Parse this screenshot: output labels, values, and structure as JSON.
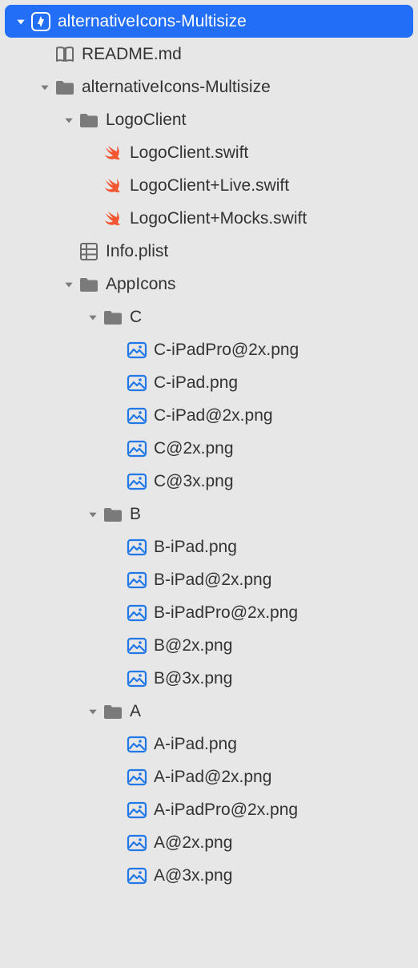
{
  "tree": {
    "root": {
      "label": "alternativeIcons-Multisize",
      "icon": "project",
      "selected": true,
      "expanded": true,
      "children": [
        {
          "label": "README.md",
          "icon": "readme",
          "expanded": null
        },
        {
          "label": "alternativeIcons-Multisize",
          "icon": "folder",
          "expanded": true,
          "children": [
            {
              "label": "LogoClient",
              "icon": "folder",
              "expanded": true,
              "children": [
                {
                  "label": "LogoClient.swift",
                  "icon": "swift",
                  "expanded": null
                },
                {
                  "label": "LogoClient+Live.swift",
                  "icon": "swift",
                  "expanded": null
                },
                {
                  "label": "LogoClient+Mocks.swift",
                  "icon": "swift",
                  "expanded": null
                }
              ]
            },
            {
              "label": "Info.plist",
              "icon": "plist",
              "expanded": null
            },
            {
              "label": "AppIcons",
              "icon": "folder",
              "expanded": true,
              "children": [
                {
                  "label": "C",
                  "icon": "folder",
                  "expanded": true,
                  "children": [
                    {
                      "label": "C-iPadPro@2x.png",
                      "icon": "image",
                      "expanded": null
                    },
                    {
                      "label": "C-iPad.png",
                      "icon": "image",
                      "expanded": null
                    },
                    {
                      "label": "C-iPad@2x.png",
                      "icon": "image",
                      "expanded": null
                    },
                    {
                      "label": "C@2x.png",
                      "icon": "image",
                      "expanded": null
                    },
                    {
                      "label": "C@3x.png",
                      "icon": "image",
                      "expanded": null
                    }
                  ]
                },
                {
                  "label": "B",
                  "icon": "folder",
                  "expanded": true,
                  "children": [
                    {
                      "label": "B-iPad.png",
                      "icon": "image",
                      "expanded": null
                    },
                    {
                      "label": "B-iPad@2x.png",
                      "icon": "image",
                      "expanded": null
                    },
                    {
                      "label": "B-iPadPro@2x.png",
                      "icon": "image",
                      "expanded": null
                    },
                    {
                      "label": "B@2x.png",
                      "icon": "image",
                      "expanded": null
                    },
                    {
                      "label": "B@3x.png",
                      "icon": "image",
                      "expanded": null
                    }
                  ]
                },
                {
                  "label": "A",
                  "icon": "folder",
                  "expanded": true,
                  "children": [
                    {
                      "label": "A-iPad.png",
                      "icon": "image",
                      "expanded": null
                    },
                    {
                      "label": "A-iPad@2x.png",
                      "icon": "image",
                      "expanded": null
                    },
                    {
                      "label": "A-iPadPro@2x.png",
                      "icon": "image",
                      "expanded": null
                    },
                    {
                      "label": "A@2x.png",
                      "icon": "image",
                      "expanded": null
                    },
                    {
                      "label": "A@3x.png",
                      "icon": "image",
                      "expanded": null
                    }
                  ]
                }
              ]
            }
          ]
        }
      ]
    }
  }
}
